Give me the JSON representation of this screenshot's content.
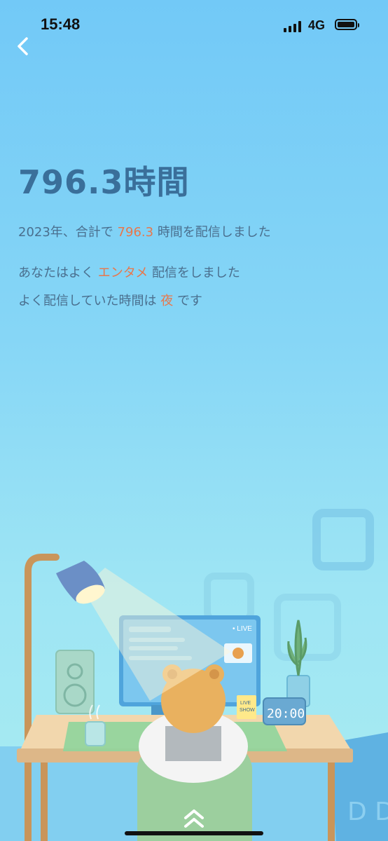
{
  "status_bar": {
    "time": "15:48",
    "network": "4G"
  },
  "summary": {
    "headline": "796.3時間",
    "line1": {
      "prefix": "2023年、合計で",
      "value": "796.3",
      "suffix": "時間を配信しました"
    },
    "line2": {
      "prefix": "あなたはよく",
      "value": "エンタメ",
      "suffix": "配信をしました"
    },
    "line3": {
      "prefix": "よく配信していた時間は",
      "value": "夜",
      "suffix": "です"
    }
  },
  "illustration": {
    "live_badge": "• LIVE",
    "sign_text_1": "LIVE",
    "sign_text_2": "SHOW",
    "clock_time": "20:00"
  },
  "colors": {
    "highlight": "#e8774b",
    "text": "#4a6f8e",
    "headline": "#3a6f9a"
  }
}
